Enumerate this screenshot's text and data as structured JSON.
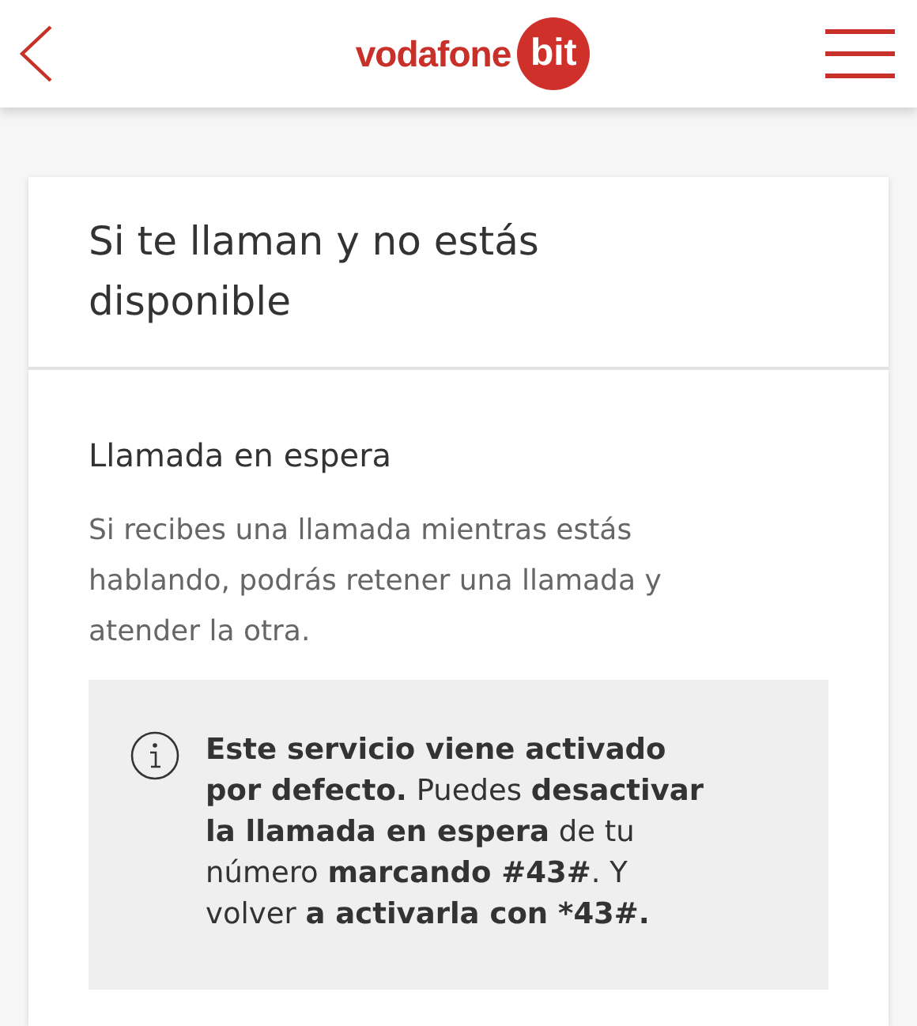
{
  "header": {
    "logo_text": "vodafone",
    "logo_badge": "bit"
  },
  "card": {
    "title": "Si te llaman y no estás disponible",
    "section": {
      "title": "Llamada en espera",
      "description": "Si recibes una llamada mientras estás hablando, podrás retener una llamada y atender la otra.",
      "info": "**Este servicio viene activado por defecto.** Puedes **desactivar la llamada en espera** de tu número **marcando #43#**. Y volver **a activarla con *43#.**"
    }
  }
}
